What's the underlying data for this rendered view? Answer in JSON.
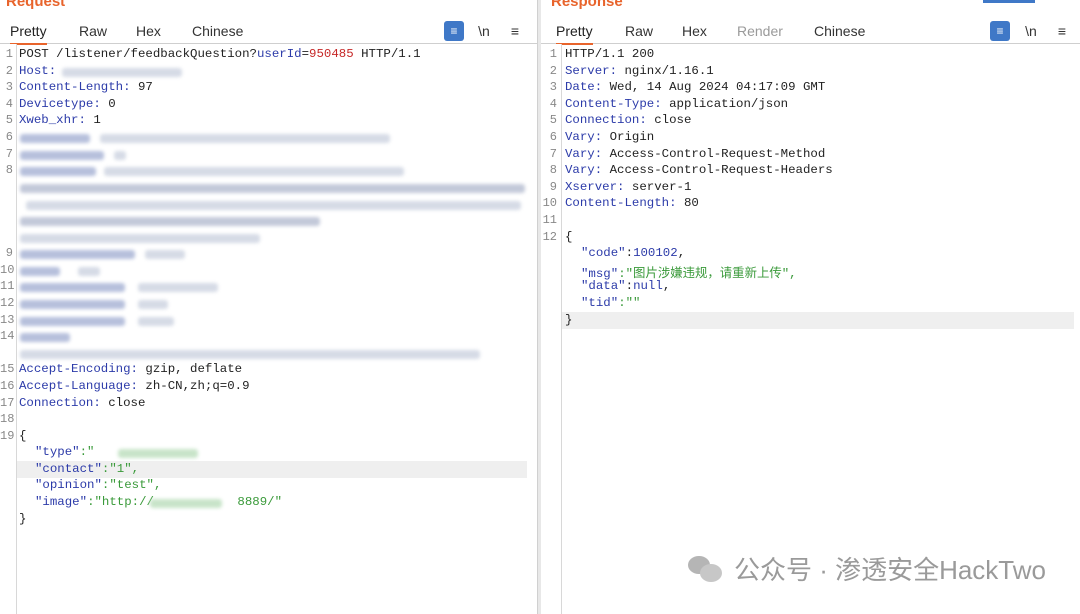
{
  "request": {
    "title": "Request",
    "tabs": [
      "Pretty",
      "Raw",
      "Hex",
      "Chinese"
    ],
    "active_tab": "Pretty",
    "tool_wrap": "≡",
    "tool_newline": "\\n",
    "tool_menu": "≡",
    "lines": {
      "l1_method": "POST /listener/feedbackQuestion?",
      "l1_param": "userId",
      "l1_eq": "=",
      "l1_value": "950485",
      "l1_proto": " HTTP/1.1",
      "l2_key": "Host:",
      "l3_key": "Content-Length:",
      "l3_val": " 97",
      "l4_key": "Devicetype:",
      "l4_val": " 0",
      "l5_key": "Xweb_xhr:",
      "l5_val": " 1",
      "l15_key": "Accept-Encoding:",
      "l15_val": " gzip, deflate",
      "l16_key": "Accept-Language:",
      "l16_val": " zh-CN,zh;q=0.9",
      "l17_key": "Connection:",
      "l17_val": " close",
      "b_open": "{",
      "type_key": "\"type\"",
      "type_colon": ":\"",
      "contact_key": "\"contact\"",
      "contact_val": ":\"1\",",
      "opinion_key": "\"opinion\"",
      "opinion_val": ":\"test\",",
      "image_key": "\"image\"",
      "image_val1": ":\"http://",
      "image_val2": " 8889/\"",
      "b_close": "}"
    },
    "line_numbers": [
      "1",
      "2",
      "3",
      "4",
      "5",
      "6",
      "7",
      "8",
      "9",
      "10",
      "11",
      "12",
      "13",
      "14",
      "15",
      "16",
      "17",
      "18",
      "19"
    ]
  },
  "response": {
    "title": "Response",
    "tabs": [
      "Pretty",
      "Raw",
      "Hex",
      "Render",
      "Chinese"
    ],
    "active_tab": "Pretty",
    "tool_wrap": "≡",
    "tool_newline": "\\n",
    "tool_menu": "≡",
    "lines": {
      "l1": "HTTP/1.1 200",
      "l2_key": "Server:",
      "l2_val": " nginx/1.16.1",
      "l3_key": "Date:",
      "l3_val": " Wed, 14 Aug 2024 04:17:09 GMT",
      "l4_key": "Content-Type:",
      "l4_val": " application/json",
      "l5_key": "Connection:",
      "l5_val": " close",
      "l6_key": "Vary:",
      "l6_val": " Origin",
      "l7_key": "Vary:",
      "l7_val": " Access-Control-Request-Method",
      "l8_key": "Vary:",
      "l8_val": " Access-Control-Request-Headers",
      "l9_key": "Xserver:",
      "l9_val": " server-1",
      "l10_key": "Content-Length:",
      "l10_val": " 80",
      "b_open": "{",
      "code_key": "\"code\"",
      "code_colon": ":",
      "code_val": "100102",
      "code_comma": ",",
      "msg_key": "\"msg\"",
      "msg_val": ":\"图片涉嫌违规，请重新上传\",",
      "data_key": "\"data\"",
      "data_colon": ":",
      "data_val": "null",
      "data_comma": ",",
      "tid_key": "\"tid\"",
      "tid_val": ":\"\"",
      "b_close": "}"
    },
    "line_numbers": [
      "1",
      "2",
      "3",
      "4",
      "5",
      "6",
      "7",
      "8",
      "9",
      "10",
      "11",
      "12"
    ]
  },
  "watermark": "公众号 · 渗透安全HackTwo"
}
